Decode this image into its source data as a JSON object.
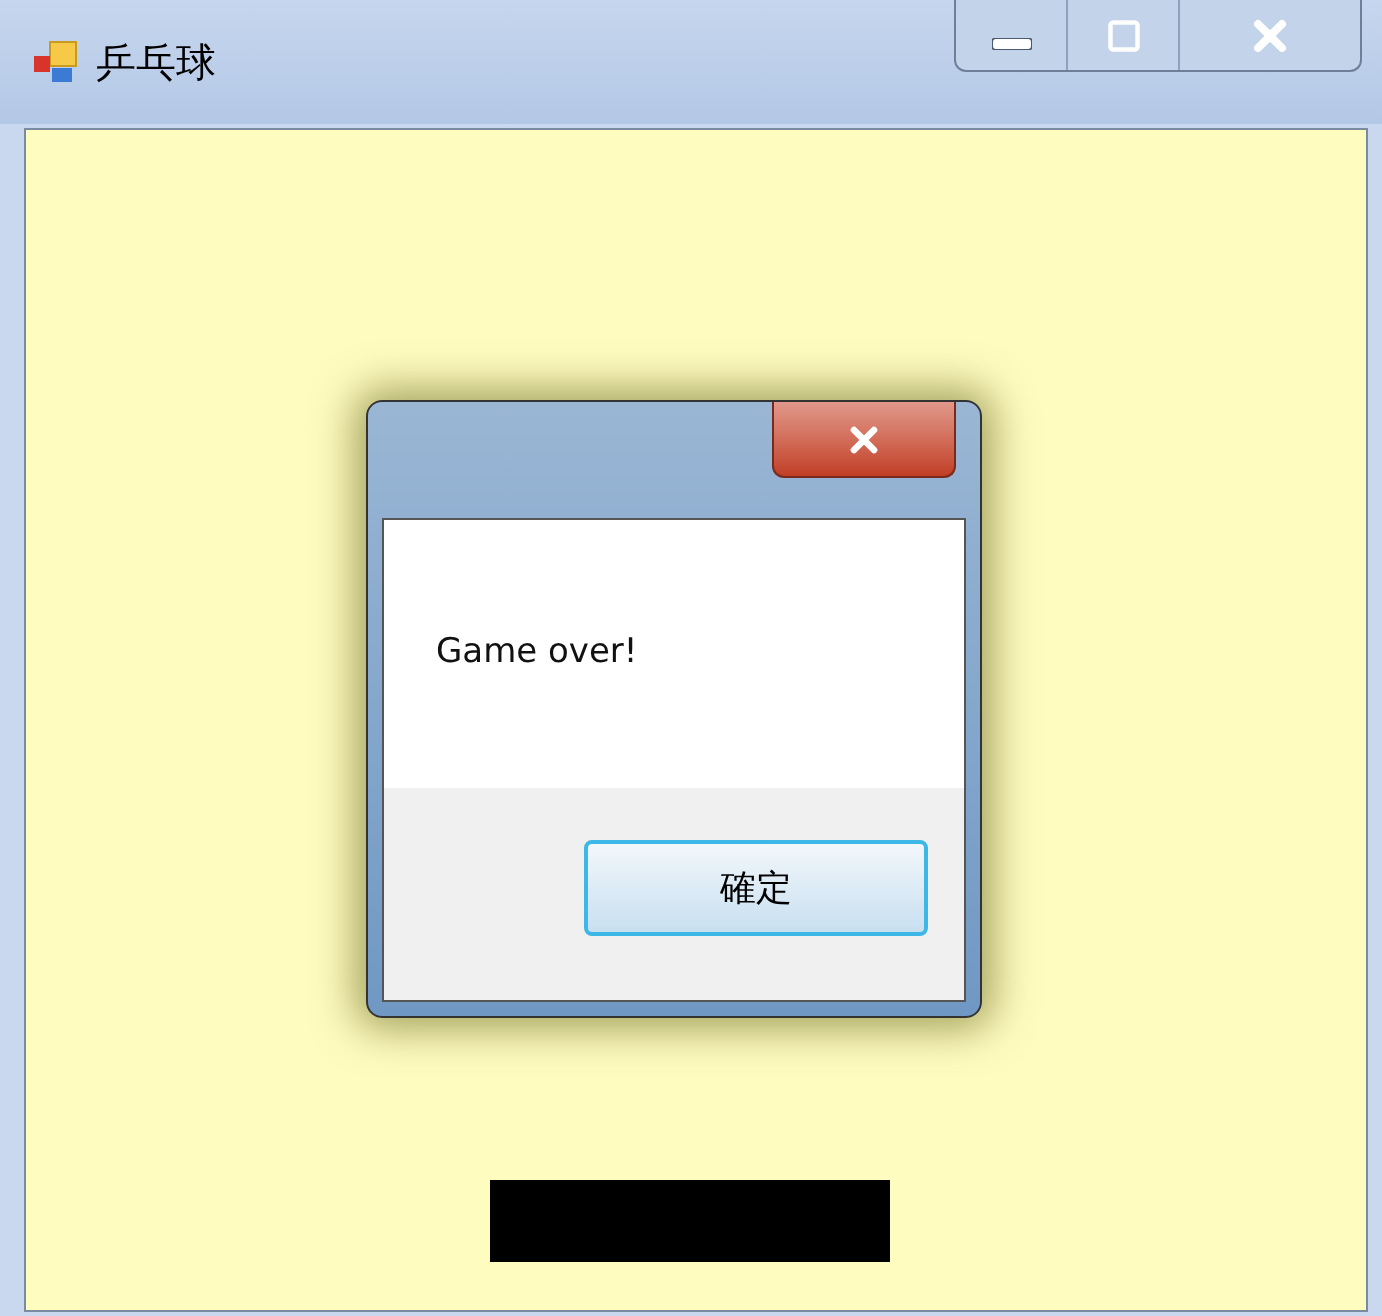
{
  "window": {
    "title": "乒乓球"
  },
  "dialog": {
    "message": "Game over!",
    "buttons": [
      {
        "label": "確定",
        "selected": true
      }
    ]
  }
}
